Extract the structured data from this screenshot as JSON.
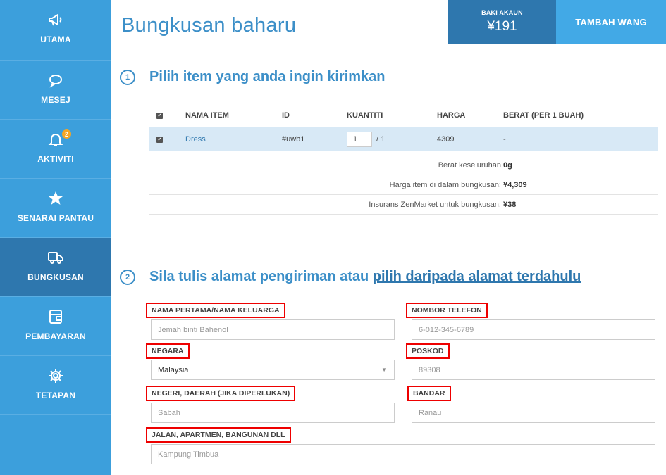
{
  "sidebar": {
    "items": [
      {
        "label": "UTAMA",
        "icon": "megaphone-icon"
      },
      {
        "label": "MESEJ",
        "icon": "chat-bubble-icon"
      },
      {
        "label": "AKTIVITI",
        "icon": "bell-icon",
        "badge": "2"
      },
      {
        "label": "SENARAI PANTAU",
        "icon": "star-icon"
      },
      {
        "label": "BUNGKUSAN",
        "icon": "delivery-truck-icon",
        "active": true
      },
      {
        "label": "PEMBAYARAN",
        "icon": "wallet-icon"
      },
      {
        "label": "TETAPAN",
        "icon": "gear-icon"
      }
    ]
  },
  "header": {
    "title": "Bungkusan baharu",
    "balance_label": "BAKI AKAUN",
    "balance_value": "¥191",
    "topup_label": "TAMBAH WANG"
  },
  "step1": {
    "number": "1",
    "title": "Pilih item yang anda ingin kirimkan",
    "columns": [
      "NAMA ITEM",
      "ID",
      "KUANTITI",
      "HARGA",
      "BERAT (PER 1 BUAH)"
    ],
    "items": [
      {
        "name": "Dress",
        "id": "#uwb1",
        "qty_value": "1",
        "qty_max": "/ 1",
        "price": "4309",
        "weight": "-"
      }
    ],
    "summary": [
      {
        "label": "Berat keseluruhan",
        "value": "0g"
      },
      {
        "label": "Harga item di dalam bungkusan:",
        "value": "¥4,309"
      },
      {
        "label": "Insurans ZenMarket untuk bungkusan:",
        "value": "¥38"
      }
    ]
  },
  "step2": {
    "number": "2",
    "title_prefix": "Sila tulis alamat pengiriman atau ",
    "title_link": "pilih daripada alamat terdahulu"
  },
  "form": {
    "name_label": "NAMA PERTAMA/NAMA KELUARGA",
    "name_value": "Jemah binti Bahenol",
    "phone_label": "NOMBOR TELEFON",
    "phone_value": "6-012-345-6789",
    "country_label": "NEGARA",
    "country_value": "Malaysia",
    "postcode_label": "POSKOD",
    "postcode_value": "89308",
    "state_label": "NEGERI, DAERAH (JIKA DIPERLUKAN)",
    "state_value": "Sabah",
    "city_label": "BANDAR",
    "city_value": "Ranau",
    "street_label": "JALAN, APARTMEN, BANGUNAN DLL",
    "street_value": "Kampung Timbua"
  },
  "colors": {
    "sidebar": "#3c9fdc",
    "sidebar_active": "#2e77ae",
    "accent": "#3c8fc8",
    "highlight_border": "#e00000",
    "badge": "#f5a623"
  }
}
